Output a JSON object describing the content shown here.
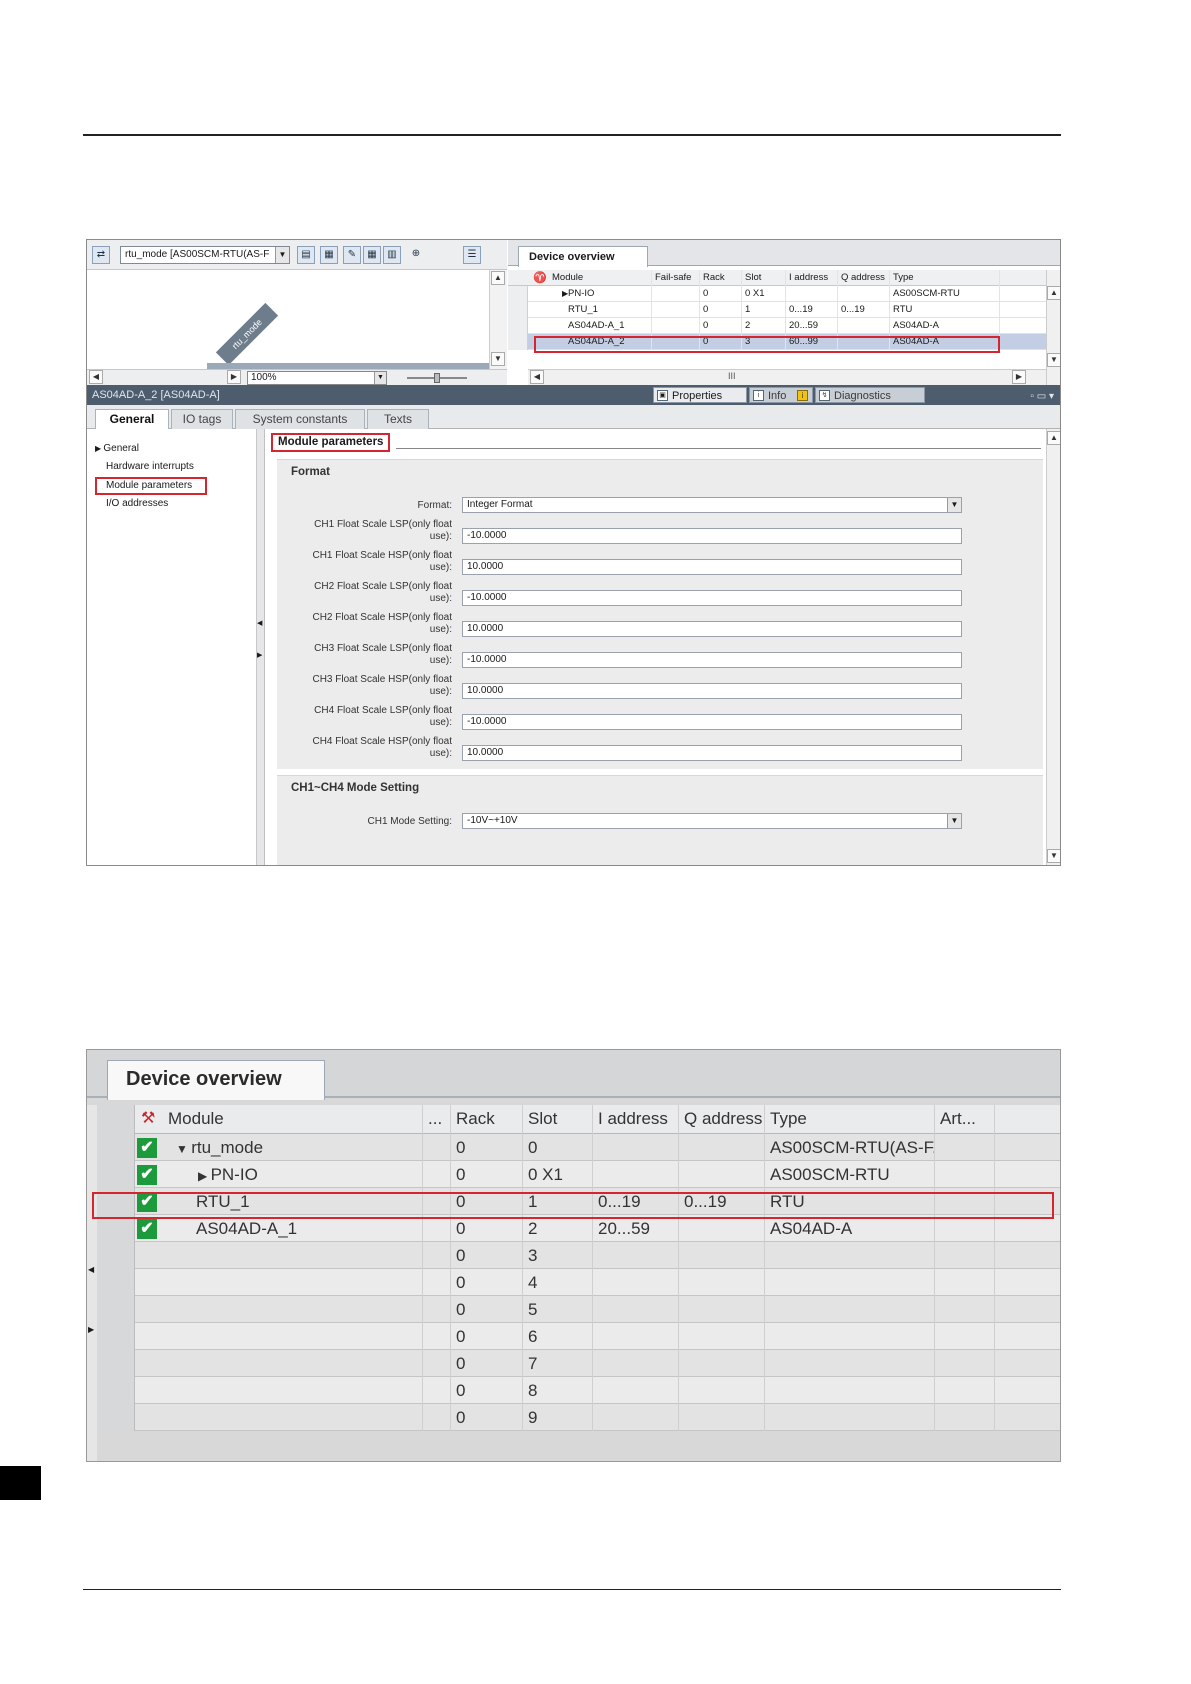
{
  "shot1": {
    "toolbar": {
      "device_select": "rtu_mode [AS00SCM-RTU(AS-F",
      "zoom": "100%"
    },
    "canvas_device_label": "rtu_mode",
    "device_overview": {
      "tab": "Device overview",
      "columns": [
        "Module",
        "Fail-safe",
        "Rack",
        "Slot",
        "I address",
        "Q address",
        "Type"
      ],
      "rows": [
        {
          "module": "PN-IO",
          "failsafe": "",
          "rack": "0",
          "slot": "0 X1",
          "i_address": "",
          "q_address": "",
          "type": "AS00SCM-RTU"
        },
        {
          "module": "RTU_1",
          "failsafe": "",
          "rack": "0",
          "slot": "1",
          "i_address": "0...19",
          "q_address": "0...19",
          "type": "RTU"
        },
        {
          "module": "AS04AD-A_1",
          "failsafe": "",
          "rack": "0",
          "slot": "2",
          "i_address": "20...59",
          "q_address": "",
          "type": "AS04AD-A"
        },
        {
          "module": "AS04AD-A_2",
          "failsafe": "",
          "rack": "0",
          "slot": "3",
          "i_address": "60...99",
          "q_address": "",
          "type": "AS04AD-A"
        }
      ],
      "scroll_mark": "III"
    },
    "title_bar": "AS04AD-A_2 [AS04AD-A]",
    "panel_tabs": {
      "properties": "Properties",
      "info": "Info",
      "diagnostics": "Diagnostics"
    },
    "tabs": [
      "General",
      "IO tags",
      "System constants",
      "Texts"
    ],
    "nav": [
      "General",
      "Hardware interrupts",
      "Module parameters",
      "I/O addresses"
    ],
    "section_title": "Module parameters",
    "format_section": {
      "title": "Format",
      "format_label": "Format:",
      "format_value": "Integer Format",
      "params": [
        {
          "line1": "CH1 Float Scale LSP(only float",
          "line2": "use):",
          "value": "-10.0000"
        },
        {
          "line1": "CH1 Float Scale HSP(only float",
          "line2": "use):",
          "value": "10.0000"
        },
        {
          "line1": "CH2 Float Scale LSP(only float",
          "line2": "use):",
          "value": "-10.0000"
        },
        {
          "line1": "CH2 Float Scale HSP(only float",
          "line2": "use):",
          "value": "10.0000"
        },
        {
          "line1": "CH3 Float Scale LSP(only float",
          "line2": "use):",
          "value": "-10.0000"
        },
        {
          "line1": "CH3 Float Scale HSP(only float",
          "line2": "use):",
          "value": "10.0000"
        },
        {
          "line1": "CH4 Float Scale LSP(only float",
          "line2": "use):",
          "value": "-10.0000"
        },
        {
          "line1": "CH4 Float Scale HSP(only float",
          "line2": "use):",
          "value": "10.0000"
        }
      ]
    },
    "mode_section": {
      "title": "CH1~CH4 Mode Setting",
      "ch1_label": "CH1 Mode Setting:",
      "ch1_value": "-10V~+10V"
    }
  },
  "shot2": {
    "tab": "Device overview",
    "columns": [
      "Module",
      "...",
      "Rack",
      "Slot",
      "I address",
      "Q address",
      "Type",
      "Art..."
    ],
    "rows": [
      {
        "module": "rtu_mode",
        "expander": "▼",
        "rack": "0",
        "slot": "0",
        "i_address": "",
        "q_address": "",
        "type": "AS00SCM-RTU(AS-F...",
        "check": true
      },
      {
        "module": "PN-IO",
        "expander": "▶",
        "rack": "0",
        "slot": "0 X1",
        "i_address": "",
        "q_address": "",
        "type": "AS00SCM-RTU",
        "check": true
      },
      {
        "module": "RTU_1",
        "expander": "",
        "rack": "0",
        "slot": "1",
        "i_address": "0...19",
        "q_address": "0...19",
        "type": "RTU",
        "check": true
      },
      {
        "module": "AS04AD-A_1",
        "expander": "",
        "rack": "0",
        "slot": "2",
        "i_address": "20...59",
        "q_address": "",
        "type": "AS04AD-A",
        "check": true
      },
      {
        "module": "",
        "expander": "",
        "rack": "0",
        "slot": "3",
        "i_address": "",
        "q_address": "",
        "type": "",
        "check": false
      },
      {
        "module": "",
        "expander": "",
        "rack": "0",
        "slot": "4",
        "i_address": "",
        "q_address": "",
        "type": "",
        "check": false
      },
      {
        "module": "",
        "expander": "",
        "rack": "0",
        "slot": "5",
        "i_address": "",
        "q_address": "",
        "type": "",
        "check": false
      },
      {
        "module": "",
        "expander": "",
        "rack": "0",
        "slot": "6",
        "i_address": "",
        "q_address": "",
        "type": "",
        "check": false
      },
      {
        "module": "",
        "expander": "",
        "rack": "0",
        "slot": "7",
        "i_address": "",
        "q_address": "",
        "type": "",
        "check": false
      },
      {
        "module": "",
        "expander": "",
        "rack": "0",
        "slot": "8",
        "i_address": "",
        "q_address": "",
        "type": "",
        "check": false
      },
      {
        "module": "",
        "expander": "",
        "rack": "0",
        "slot": "9",
        "i_address": "",
        "q_address": "",
        "type": "",
        "check": false
      }
    ]
  },
  "colors": {
    "highlight_red": "#d3262f",
    "check_green": "#1c9a3c",
    "selected_row": "#c3cee4",
    "title_bar": "#4d5d6d"
  }
}
